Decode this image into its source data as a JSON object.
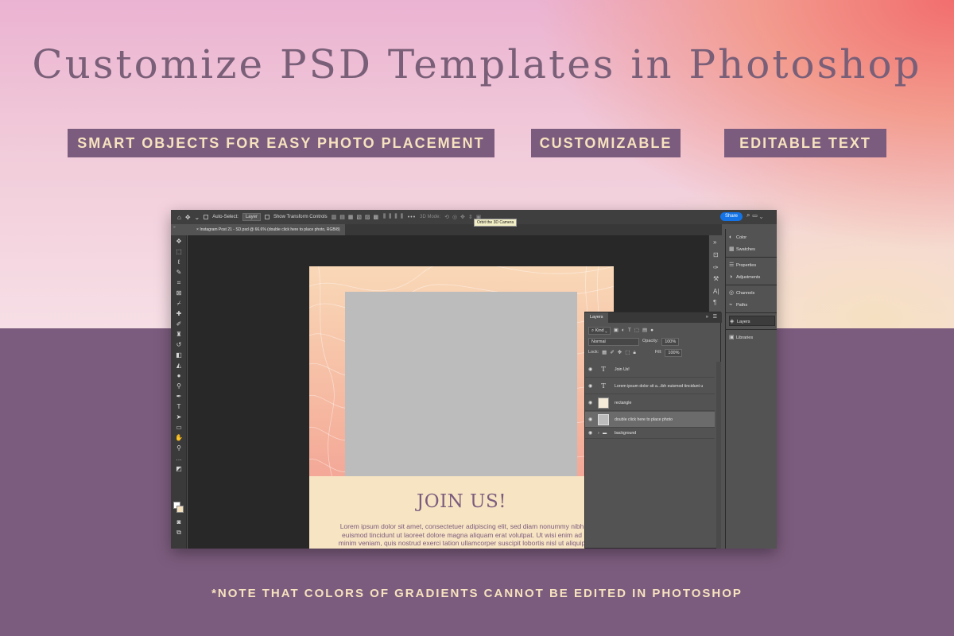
{
  "promo": {
    "headline": "Customize PSD Templates in Photoshop",
    "badges": [
      "SMART OBJECTS FOR EASY PHOTO PLACEMENT",
      "CUSTOMIZABLE",
      "EDITABLE TEXT"
    ],
    "footnote": "*NOTE THAT COLORS OF GRADIENTS CANNOT BE EDITED IN PHOTOSHOP"
  },
  "colors": {
    "brand_purple": "#7c5c7e",
    "cream": "#f7e2bf",
    "gradient_pink": "#ebb3d2",
    "gradient_coral": "#f26e6e",
    "share_blue": "#1473e6",
    "placeholder_gray": "#bcbcbc"
  },
  "photoshop": {
    "options_bar": {
      "home_icon": "home-icon",
      "move_icon": "move-tool-icon",
      "auto_select_label": "Auto-Select:",
      "auto_select_value": "Layer",
      "show_transform_label": "Show Transform Controls",
      "three_d_mode_label": "3D Mode:",
      "tooltip": "Orbit the 3D Camera",
      "share_label": "Share"
    },
    "document_tab": "Instagram Post 21 - SD.psd @ 66.6% (double click here to place photo, RGB/8)",
    "artboard": {
      "title": "JOIN US!",
      "body": "Lorem ipsum dolor sit amet, consectetuer adipiscing elit, sed diam nonummy nibh euismod tincidunt ut laoreet dolore magna aliquam erat volutpat. Ut wisi enim ad minim veniam, quis nostrud exerci tation ullamcorper suscipit lobortis nisl ut aliquip"
    },
    "side_panels": {
      "items": [
        {
          "label": "Color",
          "icon": "color-wheel-icon"
        },
        {
          "label": "Swatches",
          "icon": "swatches-grid-icon"
        },
        {
          "label": "Properties",
          "icon": "properties-sliders-icon"
        },
        {
          "label": "Adjustments",
          "icon": "adjustments-circle-icon"
        },
        {
          "label": "Channels",
          "icon": "channels-icon"
        },
        {
          "label": "Paths",
          "icon": "paths-icon"
        },
        {
          "label": "Layers",
          "icon": "layers-stack-icon"
        },
        {
          "label": "Libraries",
          "icon": "libraries-icon"
        }
      ],
      "active": "Layers"
    },
    "layers_panel": {
      "tab_label": "Layers",
      "filter_kind": "Kind",
      "blend_mode": "Normal",
      "opacity_label": "Opacity:",
      "opacity_value": "100%",
      "lock_label": "Lock:",
      "fill_label": "Fill:",
      "fill_value": "100%",
      "layers": [
        {
          "name": "Join Us!",
          "type": "text",
          "visible": true,
          "selected": false
        },
        {
          "name": "Lorem ipsum dolor sit a...ibh euismod tincidunt u",
          "type": "text",
          "visible": true,
          "selected": false
        },
        {
          "name": "rectangle",
          "type": "shape",
          "visible": true,
          "selected": false
        },
        {
          "name": "double click here to place photo",
          "type": "smart-object",
          "visible": true,
          "selected": true
        },
        {
          "name": "background",
          "type": "group",
          "visible": true,
          "selected": false
        }
      ]
    }
  }
}
